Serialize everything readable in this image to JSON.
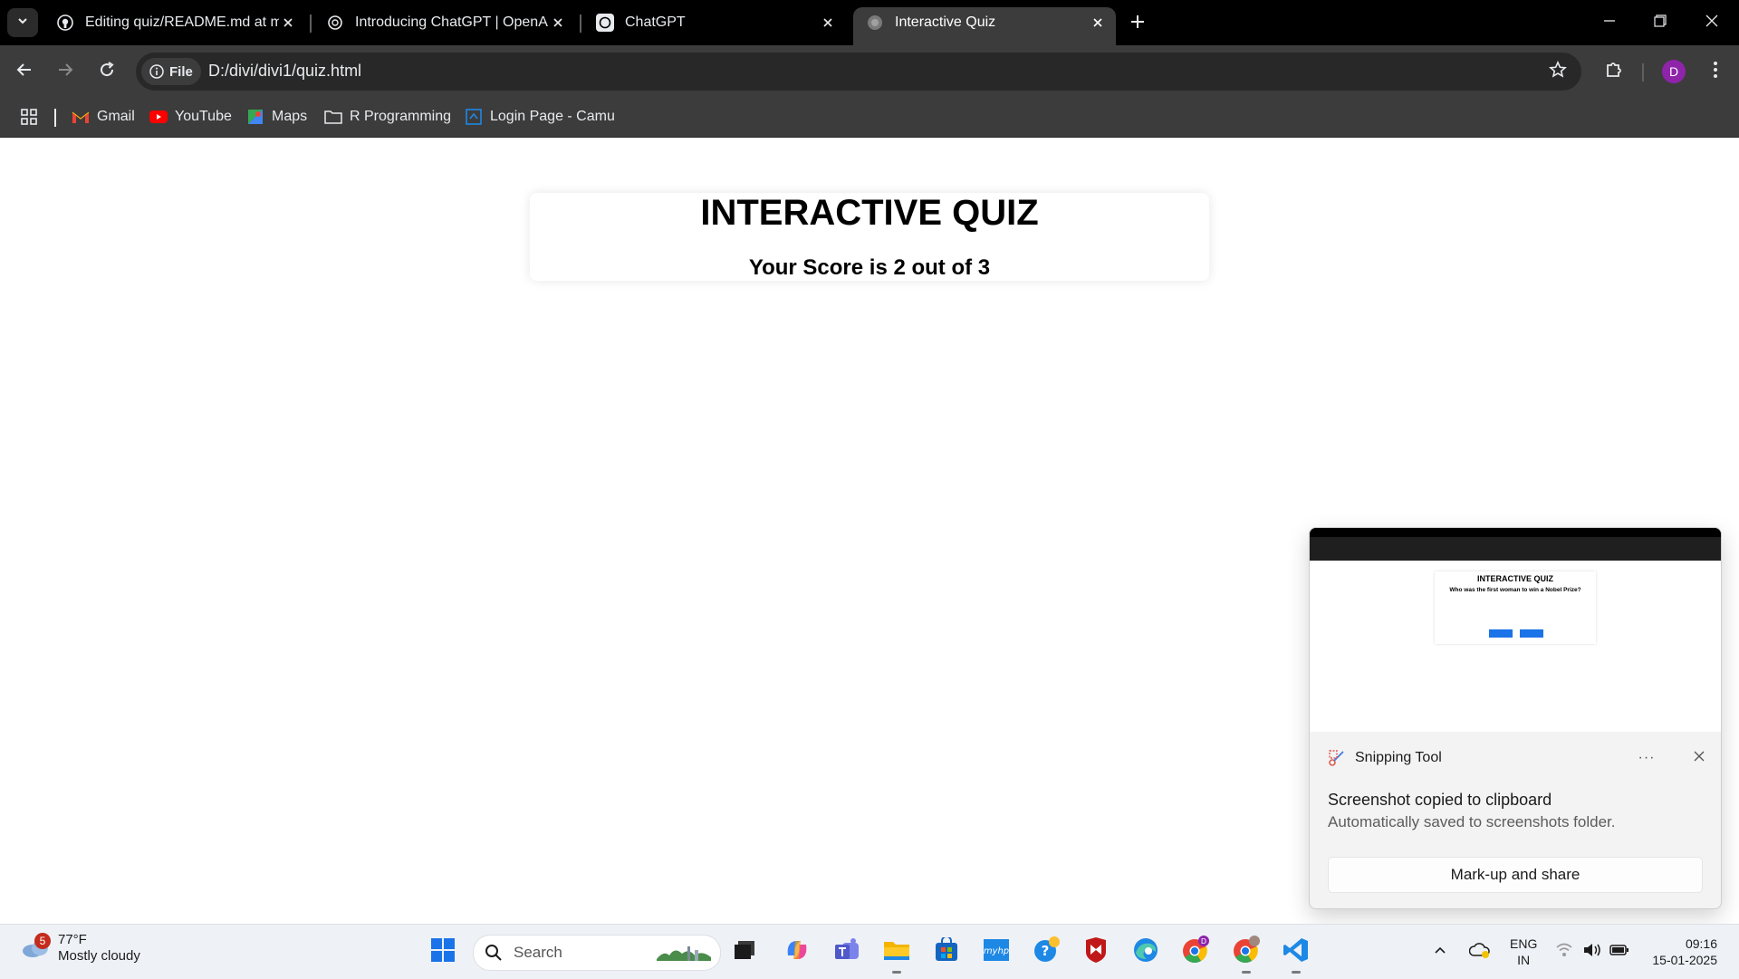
{
  "browser": {
    "tabs": [
      {
        "title": "Editing quiz/README.md at ma",
        "icon": "github-icon",
        "active": false
      },
      {
        "title": "Introducing ChatGPT | OpenAI",
        "icon": "openai-icon",
        "active": false
      },
      {
        "title": "ChatGPT",
        "icon": "chatgpt-icon",
        "active": false
      },
      {
        "title": "Interactive Quiz",
        "icon": "globe-icon",
        "active": true
      }
    ],
    "site_chip": "File",
    "url": "D:/divi/divi1/quiz.html",
    "profile_initial": "D",
    "bookmarks": [
      {
        "label": "Gmail",
        "icon": "gmail-icon"
      },
      {
        "label": "YouTube",
        "icon": "youtube-icon"
      },
      {
        "label": "Maps",
        "icon": "maps-icon"
      },
      {
        "label": "R Programming",
        "icon": "folder-icon"
      },
      {
        "label": "Login Page - Camu",
        "icon": "camu-icon"
      }
    ]
  },
  "page": {
    "title": "INTERACTIVE QUIZ",
    "score_text": "Your Score is 2 out of 3"
  },
  "toast": {
    "app_name": "Snipping Tool",
    "more": "···",
    "message": "Screenshot copied to clipboard",
    "sub_message": "Automatically saved to screenshots folder.",
    "action": "Mark-up and share",
    "thumbnail": {
      "title": "INTERACTIVE QUIZ",
      "question": "Who was the first woman to win a Nobel Prize?"
    }
  },
  "taskbar": {
    "weather_badge": "5",
    "temperature": "77°F",
    "weather": "Mostly cloudy",
    "search_placeholder": "Search",
    "language": "ENG",
    "region": "IN",
    "time": "09:16",
    "date": "15-01-2025"
  },
  "colors": {
    "tab_strip": "#000000",
    "toolbar": "#3c3c3c",
    "omnibox": "#282828",
    "avatar": "#8e24aa",
    "taskbar": "#eef1f6"
  }
}
